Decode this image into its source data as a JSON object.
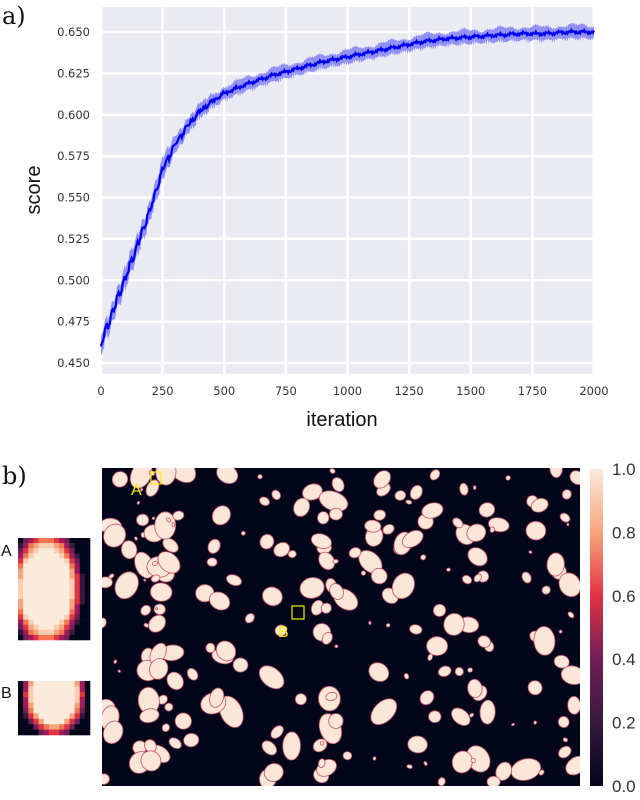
{
  "panels": {
    "a_label": "a)",
    "b_label": "b)"
  },
  "chart_data": [
    {
      "type": "line",
      "title": "",
      "xlabel": "iteration",
      "ylabel": "score",
      "xlim": [
        0,
        2000
      ],
      "ylim": [
        0.445,
        0.662
      ],
      "grid": true,
      "xticks": [
        0,
        250,
        500,
        750,
        1000,
        1250,
        1500,
        1750,
        2000
      ],
      "xtick_labels": [
        "0",
        "250",
        "500",
        "750",
        "1000",
        "1250",
        "1500",
        "1750",
        "2000"
      ],
      "yticks": [
        0.45,
        0.475,
        0.5,
        0.525,
        0.55,
        0.575,
        0.6,
        0.625,
        0.65
      ],
      "ytick_labels": [
        "0.450",
        "0.475",
        "0.500",
        "0.525",
        "0.550",
        "0.575",
        "0.600",
        "0.625",
        "0.650"
      ],
      "series": [
        {
          "name": "score",
          "color": "#0000ee",
          "band_color": "#8080f8",
          "x": [
            0,
            50,
            100,
            150,
            200,
            250,
            300,
            350,
            400,
            450,
            500,
            600,
            700,
            800,
            900,
            1000,
            1100,
            1200,
            1300,
            1400,
            1500,
            1600,
            1700,
            1800,
            1900,
            2000
          ],
          "values": [
            0.462,
            0.482,
            0.502,
            0.522,
            0.543,
            0.567,
            0.582,
            0.593,
            0.602,
            0.608,
            0.613,
            0.619,
            0.624,
            0.628,
            0.632,
            0.635,
            0.638,
            0.641,
            0.644,
            0.646,
            0.647,
            0.648,
            0.649,
            0.649,
            0.65,
            0.65
          ],
          "band_halfwidth": [
            0.006,
            0.006,
            0.006,
            0.006,
            0.006,
            0.006,
            0.005,
            0.005,
            0.004,
            0.004,
            0.004,
            0.004,
            0.004,
            0.004,
            0.004,
            0.004,
            0.004,
            0.004,
            0.004,
            0.004,
            0.004,
            0.004,
            0.004,
            0.004,
            0.004,
            0.004
          ]
        }
      ]
    },
    {
      "type": "heatmap",
      "title": "",
      "colormap": "rocket",
      "colorbar": {
        "range": [
          0.0,
          1.0
        ],
        "ticks": [
          0.0,
          0.2,
          0.4,
          0.6,
          0.8,
          1.0
        ],
        "tick_labels": [
          "0.0",
          "0.2",
          "0.4",
          "0.6",
          "0.8",
          "1.0"
        ]
      },
      "annotations": [
        {
          "label": "A",
          "color": "#f5f000"
        },
        {
          "label": "B",
          "color": "#f5f000"
        }
      ],
      "insets": [
        {
          "label": "A"
        },
        {
          "label": "B"
        }
      ],
      "background_color": "#03051a",
      "blob_color": "#fbe6d8"
    }
  ]
}
